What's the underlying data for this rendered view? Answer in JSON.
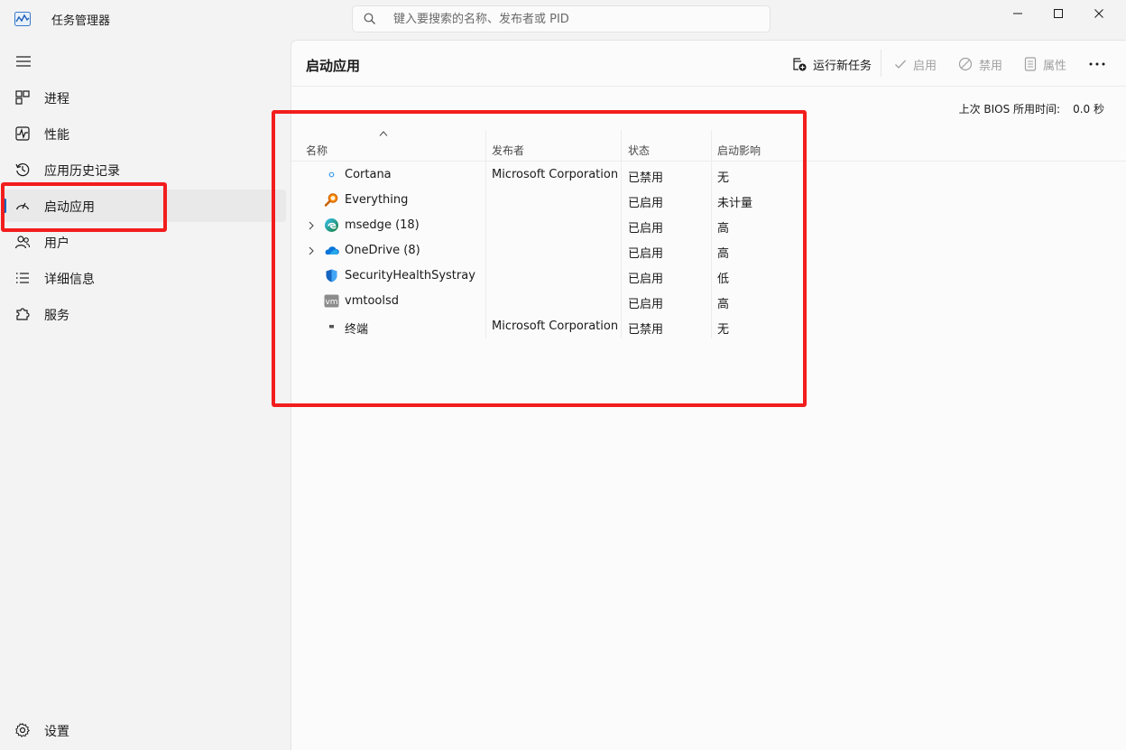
{
  "app": {
    "title": "任务管理器",
    "search_placeholder": "键入要搜索的名称、发布者或 PID"
  },
  "sidebar": {
    "items": [
      {
        "label": "进程",
        "icon": "processes-grid-icon"
      },
      {
        "label": "性能",
        "icon": "performance-chart-icon"
      },
      {
        "label": "应用历史记录",
        "icon": "history-clock-icon"
      },
      {
        "label": "启动应用",
        "icon": "startup-gauge-icon",
        "active": true
      },
      {
        "label": "用户",
        "icon": "users-icon"
      },
      {
        "label": "详细信息",
        "icon": "details-list-icon"
      },
      {
        "label": "服务",
        "icon": "services-puzzle-icon"
      }
    ],
    "settings_label": "设置"
  },
  "main": {
    "title": "启动应用",
    "toolbar": {
      "run_new_task": "运行新任务",
      "enable": "启用",
      "disable": "禁用",
      "properties": "属性"
    },
    "bios_label": "上次 BIOS 所用时间:",
    "bios_value": "0.0 秒",
    "columns": {
      "name": "名称",
      "publisher": "发布者",
      "status": "状态",
      "impact": "启动影响"
    },
    "rows": [
      {
        "name": "Cortana",
        "publisher": "Microsoft Corporation",
        "status": "已禁用",
        "impact": "无",
        "icon": "cortana-icon",
        "expandable": false
      },
      {
        "name": "Everything",
        "publisher": "",
        "status": "已启用",
        "impact": "未计量",
        "icon": "everything-magnifier-icon",
        "expandable": false
      },
      {
        "name": "msedge (18)",
        "publisher": "",
        "status": "已启用",
        "impact": "高",
        "icon": "edge-icon",
        "expandable": true
      },
      {
        "name": "OneDrive (8)",
        "publisher": "",
        "status": "已启用",
        "impact": "高",
        "icon": "onedrive-cloud-icon",
        "expandable": true
      },
      {
        "name": "SecurityHealthSystray",
        "publisher": "",
        "status": "已启用",
        "impact": "低",
        "icon": "security-shield-icon",
        "expandable": false
      },
      {
        "name": "vmtoolsd",
        "publisher": "",
        "status": "已启用",
        "impact": "高",
        "icon": "vmware-icon",
        "expandable": false
      },
      {
        "name": "终端",
        "publisher": "Microsoft Corporation",
        "status": "已禁用",
        "impact": "无",
        "icon": "terminal-icon",
        "expandable": false
      }
    ]
  },
  "colors": {
    "annotation_red": "#f21d1d",
    "accent_blue": "#0067c0"
  }
}
